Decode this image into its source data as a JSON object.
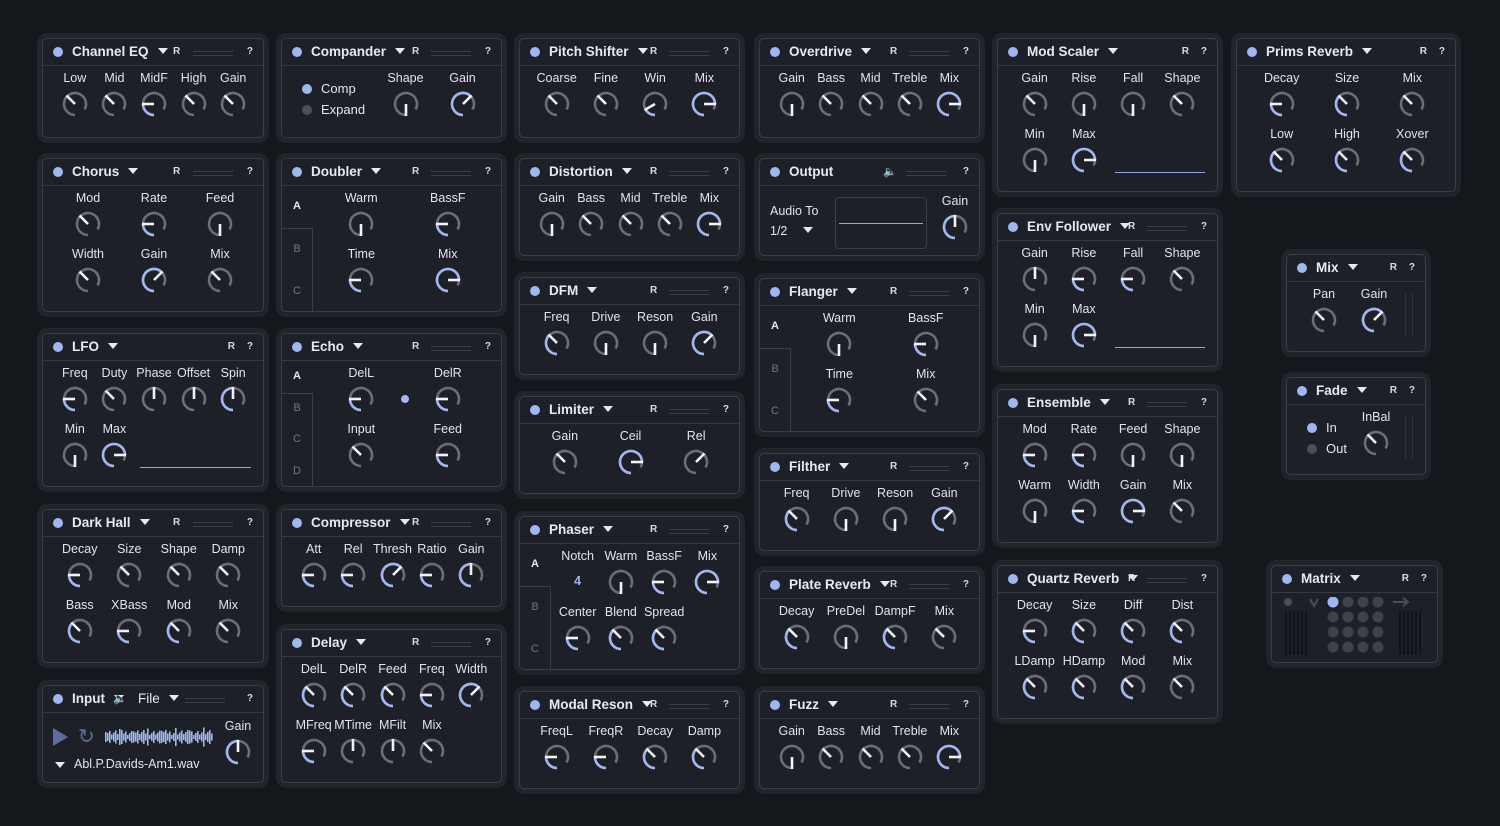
{
  "accent": "#9fb6f2",
  "header": {
    "r_label": "R",
    "help_label": "?"
  },
  "panels": [
    {
      "title": "Channel EQ",
      "bar": true,
      "rows": [
        [
          {
            "label": "Low",
            "value": 0.45
          },
          {
            "label": "Mid",
            "value": 0.45
          },
          {
            "label": "MidF",
            "value": 0.3,
            "accent": true
          },
          {
            "label": "High",
            "value": 0.45
          },
          {
            "label": "Gain",
            "value": 0.45
          }
        ]
      ]
    },
    {
      "title": "Chorus",
      "bar": true,
      "rows": [
        [
          {
            "label": "Mod",
            "value": 0.45
          },
          {
            "label": "Rate",
            "value": 0.3,
            "accent": true
          },
          {
            "label": "Feed",
            "value": 0
          }
        ],
        [
          {
            "label": "Width",
            "value": 0.45
          },
          {
            "label": "Gain",
            "value": 0.75,
            "accent": true
          },
          {
            "label": "Mix",
            "value": 0.45
          }
        ]
      ]
    },
    {
      "title": "LFO",
      "bar": false,
      "line": true,
      "rows": [
        [
          {
            "label": "Freq",
            "value": 0.3,
            "accent": true
          },
          {
            "label": "Duty",
            "value": 0.45
          },
          {
            "label": "Phase",
            "value": 0.6
          },
          {
            "label": "Offset",
            "value": 0.6
          },
          {
            "label": "Spin",
            "value": 0.6,
            "accent": true
          }
        ],
        [
          {
            "label": "Min",
            "value": 0
          },
          {
            "label": "Max",
            "value": 0.9,
            "accent": true
          }
        ]
      ]
    },
    {
      "title": "Dark Hall",
      "bar": true,
      "rows": [
        [
          {
            "label": "Decay",
            "value": 0.3,
            "accent": true
          },
          {
            "label": "Size",
            "value": 0.45
          },
          {
            "label": "Shape",
            "value": 0.45
          },
          {
            "label": "Damp",
            "value": 0.45
          }
        ],
        [
          {
            "label": "Bass",
            "value": 0.45,
            "accent": true
          },
          {
            "label": "XBass",
            "value": 0.3,
            "accent": true
          },
          {
            "label": "Mod",
            "value": 0.45,
            "accent": true
          },
          {
            "label": "Mix",
            "value": 0.45
          }
        ]
      ]
    },
    {
      "title": "Input",
      "kind": "input",
      "source": "File",
      "filename": "Abl.P.Davids-Am1.wav",
      "rows": [
        [
          {
            "label": "Gain",
            "value": 0.6,
            "accent": true
          }
        ]
      ]
    },
    {
      "title": "Compander",
      "bar": true,
      "kind": "radio",
      "options": [
        {
          "label": "Comp",
          "on": true
        },
        {
          "label": "Expand",
          "on": false
        }
      ],
      "rows": [
        [
          {
            "label": "Shape",
            "value": 0
          },
          {
            "label": "Gain",
            "value": 0.75,
            "accent": true
          }
        ]
      ]
    },
    {
      "title": "Doubler",
      "bar": true,
      "tabs": [
        "A",
        "B",
        "C"
      ],
      "rows": [
        [
          {
            "label": "Warm",
            "value": 0
          },
          {
            "label": "BassF",
            "value": 0.3,
            "accent": true
          }
        ],
        [
          {
            "label": "Time",
            "value": 0.3,
            "accent": true
          },
          {
            "label": "Mix",
            "value": 0.9,
            "accent": true
          }
        ]
      ]
    },
    {
      "title": "Echo",
      "bar": true,
      "tabs": [
        "A",
        "B",
        "C",
        "D"
      ],
      "rows": [
        [
          {
            "label": "DelL",
            "value": 0.3,
            "accent": true
          },
          {
            "label": "DelR",
            "value": 0.3,
            "accent": true
          }
        ],
        [
          {
            "label": "Input",
            "value": 0.45
          },
          {
            "label": "Feed",
            "value": 0.3,
            "accent": true
          }
        ]
      ]
    },
    {
      "title": "Compressor",
      "bar": true,
      "rows": [
        [
          {
            "label": "Att",
            "value": 0.3,
            "accent": true
          },
          {
            "label": "Rel",
            "value": 0.3,
            "accent": true
          },
          {
            "label": "Thresh",
            "value": 0.75,
            "accent": true
          },
          {
            "label": "Ratio",
            "value": 0.3,
            "accent": true
          },
          {
            "label": "Gain",
            "value": 0.6,
            "accent": true
          }
        ]
      ]
    },
    {
      "title": "Delay",
      "bar": true,
      "rows": [
        [
          {
            "label": "DelL",
            "value": 0.45,
            "accent": true
          },
          {
            "label": "DelR",
            "value": 0.45,
            "accent": true
          },
          {
            "label": "Feed",
            "value": 0.45,
            "accent": true
          },
          {
            "label": "Freq",
            "value": 0.3,
            "accent": true
          },
          {
            "label": "Width",
            "value": 0.75,
            "accent": true
          }
        ],
        [
          {
            "label": "MFreq",
            "value": 0.3,
            "accent": true
          },
          {
            "label": "MTime",
            "value": 0.6
          },
          {
            "label": "MFilt",
            "value": 0.6
          },
          {
            "label": "Mix",
            "value": 0.45
          }
        ]
      ]
    },
    {
      "title": "Pitch Shifter",
      "bar": true,
      "rows": [
        [
          {
            "label": "Coarse",
            "value": 0.45
          },
          {
            "label": "Fine",
            "value": 0.45
          },
          {
            "label": "Win",
            "value": 0.2,
            "accent": true
          },
          {
            "label": "Mix",
            "value": 0.9,
            "accent": true
          }
        ]
      ]
    },
    {
      "title": "Distortion",
      "bar": true,
      "rows": [
        [
          {
            "label": "Gain",
            "value": 0
          },
          {
            "label": "Bass",
            "value": 0.45
          },
          {
            "label": "Mid",
            "value": 0.45
          },
          {
            "label": "Treble",
            "value": 0.45
          },
          {
            "label": "Mix",
            "value": 0.9,
            "accent": true
          }
        ]
      ]
    },
    {
      "title": "DFM",
      "bar": true,
      "rows": [
        [
          {
            "label": "Freq",
            "value": 0.45,
            "accent": true
          },
          {
            "label": "Drive",
            "value": 0
          },
          {
            "label": "Reson",
            "value": 0
          },
          {
            "label": "Gain",
            "value": 0.75,
            "accent": true
          }
        ]
      ]
    },
    {
      "title": "Limiter",
      "bar": true,
      "rows": [
        [
          {
            "label": "Gain",
            "value": 0.45
          },
          {
            "label": "Ceil",
            "value": 0.9,
            "accent": true
          },
          {
            "label": "Rel",
            "value": 0.75
          }
        ]
      ]
    },
    {
      "title": "Phaser",
      "bar": true,
      "tabs": [
        "A",
        "B",
        "C"
      ],
      "notch_value": "4",
      "rows": [
        [
          {
            "label": "Notch",
            "value": null
          },
          {
            "label": "Warm",
            "value": 0
          },
          {
            "label": "BassF",
            "value": 0.3,
            "accent": true
          },
          {
            "label": "Mix",
            "value": 0.9,
            "accent": true
          }
        ],
        [
          {
            "label": "Center",
            "value": 0.3,
            "accent": true
          },
          {
            "label": "Blend",
            "value": 0.45,
            "accent": true
          },
          {
            "label": "Spread",
            "value": 0.45,
            "accent": true
          }
        ]
      ]
    },
    {
      "title": "Modal Reson",
      "bar": true,
      "rows": [
        [
          {
            "label": "FreqL",
            "value": 0.3,
            "accent": true
          },
          {
            "label": "FreqR",
            "value": 0.3,
            "accent": true
          },
          {
            "label": "Decay",
            "value": 0.45,
            "accent": true
          },
          {
            "label": "Damp",
            "value": 0.45,
            "accent": true
          }
        ]
      ]
    },
    {
      "title": "Overdrive",
      "bar": true,
      "rows": [
        [
          {
            "label": "Gain",
            "value": 0
          },
          {
            "label": "Bass",
            "value": 0.45
          },
          {
            "label": "Mid",
            "value": 0.45
          },
          {
            "label": "Treble",
            "value": 0.45
          },
          {
            "label": "Mix",
            "value": 0.9,
            "accent": true
          }
        ]
      ]
    },
    {
      "title": "Output",
      "kind": "output",
      "route_label": "Audio To",
      "route_value": "1/2",
      "rows": [
        [
          {
            "label": "Gain",
            "value": 0.6,
            "accent": true
          }
        ]
      ]
    },
    {
      "title": "Flanger",
      "bar": true,
      "tabs": [
        "A",
        "B",
        "C"
      ],
      "rows": [
        [
          {
            "label": "Warm",
            "value": 0
          },
          {
            "label": "BassF",
            "value": 0.3,
            "accent": true
          }
        ],
        [
          {
            "label": "Time",
            "value": 0.3,
            "accent": true
          },
          {
            "label": "Mix",
            "value": 0.45
          }
        ]
      ]
    },
    {
      "title": "Filther",
      "bar": true,
      "rows": [
        [
          {
            "label": "Freq",
            "value": 0.45,
            "accent": true
          },
          {
            "label": "Drive",
            "value": 0
          },
          {
            "label": "Reson",
            "value": 0
          },
          {
            "label": "Gain",
            "value": 0.75,
            "accent": true
          }
        ]
      ]
    },
    {
      "title": "Plate Reverb",
      "bar": true,
      "rows": [
        [
          {
            "label": "Decay",
            "value": 0.45,
            "accent": true
          },
          {
            "label": "PreDel",
            "value": 0
          },
          {
            "label": "DampF",
            "value": 0.45,
            "accent": true
          },
          {
            "label": "Mix",
            "value": 0.45
          }
        ]
      ]
    },
    {
      "title": "Fuzz",
      "bar": true,
      "rows": [
        [
          {
            "label": "Gain",
            "value": 0
          },
          {
            "label": "Bass",
            "value": 0.45
          },
          {
            "label": "Mid",
            "value": 0.45
          },
          {
            "label": "Treble",
            "value": 0.45
          },
          {
            "label": "Mix",
            "value": 0.9,
            "accent": true
          }
        ]
      ]
    },
    {
      "title": "Mod Scaler",
      "bar": false,
      "line": true,
      "rows": [
        [
          {
            "label": "Gain",
            "value": 0.45
          },
          {
            "label": "Rise",
            "value": 0
          },
          {
            "label": "Fall",
            "value": 0
          },
          {
            "label": "Shape",
            "value": 0.45
          }
        ],
        [
          {
            "label": "Min",
            "value": 0
          },
          {
            "label": "Max",
            "value": 0.9,
            "accent": true
          }
        ]
      ]
    },
    {
      "title": "Env Follower",
      "bar": true,
      "line": true,
      "rows": [
        [
          {
            "label": "Gain",
            "value": 0.6
          },
          {
            "label": "Rise",
            "value": 0.3,
            "accent": true
          },
          {
            "label": "Fall",
            "value": 0.3,
            "accent": true
          },
          {
            "label": "Shape",
            "value": 0.45
          }
        ],
        [
          {
            "label": "Min",
            "value": 0
          },
          {
            "label": "Max",
            "value": 0.9,
            "accent": true
          }
        ]
      ]
    },
    {
      "title": "Ensemble",
      "bar": true,
      "rows": [
        [
          {
            "label": "Mod",
            "value": 0.3,
            "accent": true
          },
          {
            "label": "Rate",
            "value": 0.3,
            "accent": true
          },
          {
            "label": "Feed",
            "value": 0
          },
          {
            "label": "Shape",
            "value": 0
          }
        ],
        [
          {
            "label": "Warm",
            "value": 0
          },
          {
            "label": "Width",
            "value": 0.3,
            "accent": true
          },
          {
            "label": "Gain",
            "value": 0.9,
            "accent": true
          },
          {
            "label": "Mix",
            "value": 0.45
          }
        ]
      ]
    },
    {
      "title": "Quartz Reverb",
      "bar": true,
      "rows": [
        [
          {
            "label": "Decay",
            "value": 0.3,
            "accent": true
          },
          {
            "label": "Size",
            "value": 0.45,
            "accent": true
          },
          {
            "label": "Diff",
            "value": 0.45,
            "accent": true
          },
          {
            "label": "Dist",
            "value": 0.45,
            "accent": true
          }
        ],
        [
          {
            "label": "LDamp",
            "value": 0.45,
            "accent": true
          },
          {
            "label": "HDamp",
            "value": 0.45,
            "accent": true
          },
          {
            "label": "Mod",
            "value": 0.45,
            "accent": true
          },
          {
            "label": "Mix",
            "value": 0.45
          }
        ]
      ]
    },
    {
      "title": "Prims Reverb",
      "bar": false,
      "rows": [
        [
          {
            "label": "Decay",
            "value": 0.3,
            "accent": true
          },
          {
            "label": "Size",
            "value": 0.45,
            "accent": true
          },
          {
            "label": "Mix",
            "value": 0.45
          }
        ],
        [
          {
            "label": "Low",
            "value": 0.45,
            "accent": true
          },
          {
            "label": "High",
            "value": 0.45,
            "accent": true
          },
          {
            "label": "Xover",
            "value": 0.45,
            "accent": true
          }
        ]
      ]
    },
    {
      "title": "Mix",
      "bar": false,
      "meter": true,
      "rows": [
        [
          {
            "label": "Pan",
            "value": 0.45
          },
          {
            "label": "Gain",
            "value": 0.75,
            "accent": true
          }
        ]
      ]
    },
    {
      "title": "Fade",
      "bar": false,
      "meter": true,
      "kind": "radio",
      "options": [
        {
          "label": "In",
          "on": true
        },
        {
          "label": "Out",
          "on": false
        }
      ],
      "rows": [
        [
          {
            "label": "InBal",
            "value": 0.45
          }
        ]
      ]
    },
    {
      "title": "Matrix",
      "bar": false,
      "kind": "matrix",
      "rows": []
    }
  ]
}
